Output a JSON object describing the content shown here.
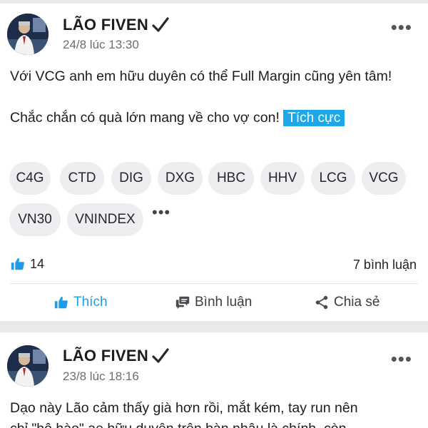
{
  "posts": [
    {
      "author": "LÃO FIVEN",
      "time": "24/8 lúc 13:30",
      "paragraph1": "Với VCG anh em hữu duyên có thể Full Margin cũng yên tâm!",
      "paragraph2": "Chắc chắn có quà lớn mang về cho vợ con!",
      "sentiment": "Tích cực",
      "tags": [
        "C4G",
        "CTD",
        "DIG",
        "DXG",
        "HBC",
        "HHV",
        "LCG",
        "VCG",
        "VN30",
        "VNINDEX"
      ],
      "likes": "14",
      "comments": "7 bình luận",
      "actions": {
        "like": "Thích",
        "comment": "Bình luận",
        "share": "Chia sẻ"
      }
    },
    {
      "author": "LÃO FIVEN",
      "time": "23/8 lúc 18:16",
      "line1": "Dạo này Lão cảm thấy già hơn rồi, mắt kém, tay run nên",
      "line2": "chỉ \"hô hào\" ae hữu duyên trên bàn nhậu là chính, còn"
    }
  ],
  "colors": {
    "accent": "#1e9be9",
    "sentiment_bg": "#1ea7e8",
    "tag_bg": "#edeef0"
  },
  "icons": [
    "verified-check-icon",
    "more-options-icon",
    "thumbs-up-icon",
    "comment-icon",
    "share-icon",
    "more-tags-icon"
  ]
}
